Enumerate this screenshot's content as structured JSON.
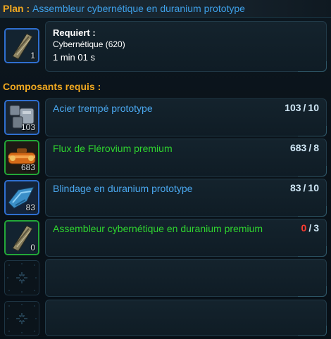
{
  "header": {
    "prefix": "Plan :",
    "title": "Assembleur cybernétique en duranium prototype"
  },
  "schematic": {
    "icon": "duranium-assembly-icon",
    "quantity": "1",
    "requires_label": "Requiert :",
    "skill": "Cybernétique (620)",
    "time": "1 min 01 s"
  },
  "components": {
    "label": "Composants requis :",
    "items": [
      {
        "name": "Acier trempé prototype",
        "have": "103",
        "need": "10",
        "qty": "103",
        "quality": "blue",
        "icon": "tempered-steel-icon"
      },
      {
        "name": "Flux de Flérovium premium",
        "have": "683",
        "need": "8",
        "qty": "683",
        "quality": "green",
        "icon": "flerovium-flux-icon"
      },
      {
        "name": "Blindage en duranium prototype",
        "have": "83",
        "need": "10",
        "qty": "83",
        "quality": "blue",
        "icon": "duranium-plating-icon"
      },
      {
        "name": "Assembleur cybernétique en duranium premium",
        "have": "0",
        "need": "3",
        "qty": "0",
        "quality": "green",
        "icon": "cybernetic-assembly-icon"
      }
    ],
    "separator": "/"
  },
  "colors": {
    "orange_label": "#f0a820",
    "blue_title": "#3ea0e8",
    "prototype_blue": "#4aa7ee",
    "premium_green": "#2fd42f",
    "missing_red": "#ff3b30"
  }
}
